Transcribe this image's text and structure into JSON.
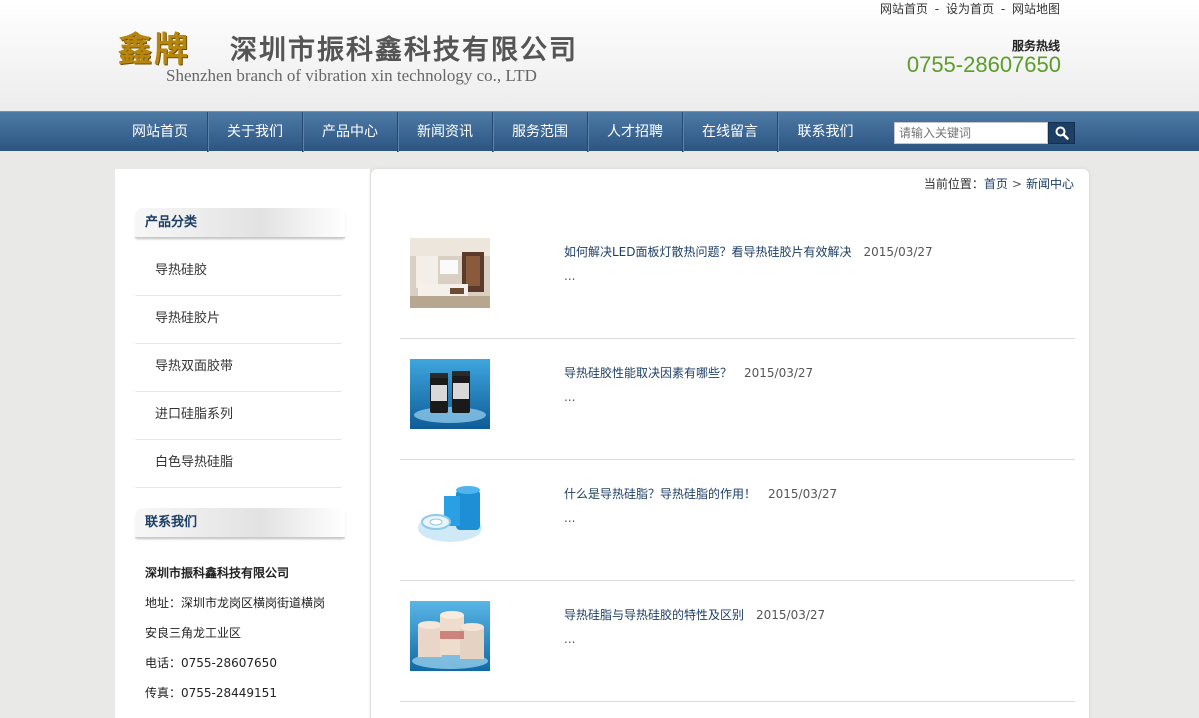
{
  "header": {
    "logo_brand": "鑫牌",
    "logo_cn": "深圳市振科鑫科技有限公司",
    "logo_en": "Shenzhen branch of vibration xin technology co., LTD",
    "top_links": [
      "网站首页",
      "设为首页",
      "网站地图"
    ],
    "top_link_sep": "-",
    "hotline_label": "服务热线",
    "hotline_number": "0755-28607650"
  },
  "nav": {
    "items": [
      "网站首页",
      "关于我们",
      "产品中心",
      "新闻资讯",
      "服务范围",
      "人才招聘",
      "在线留言",
      "联系我们"
    ],
    "search_placeholder": "请输入关键词",
    "search_icon": "search-icon"
  },
  "sidebar": {
    "category_heading": "产品分类",
    "categories": [
      "导热硅胶",
      "导热硅胶片",
      "导热双面胶带",
      "进口硅脂系列",
      "白色导热硅脂"
    ],
    "contact_heading": "联系我们",
    "contact_lines": [
      "深圳市振科鑫科技有限公司",
      "地址：深圳市龙岗区横岗街道横岗",
      "安良三角龙工业区",
      "电话：0755-28607650",
      "传真：0755-28449151"
    ]
  },
  "breadcrumb": {
    "prefix": "当前位置：",
    "home": "首页",
    "sep": ">",
    "current": "新闻中心"
  },
  "news": [
    {
      "title": "如何解决LED面板灯散热问题？看导热硅胶片有效解决",
      "date": "2015/03/27",
      "excerpt": "...",
      "thumb": "living-room-image"
    },
    {
      "title": "导热硅胶性能取决因素有哪些？",
      "date": "2015/03/27",
      "excerpt": "...",
      "thumb": "silicone-jars-image"
    },
    {
      "title": "什么是导热硅脂？导热硅脂的作用！",
      "date": "2015/03/27",
      "excerpt": "...",
      "thumb": "blue-tape-roll-image"
    },
    {
      "title": "导热硅脂与导热硅胶的特性及区别",
      "date": "2015/03/27",
      "excerpt": "...",
      "thumb": "grease-tubs-image"
    }
  ],
  "colors": {
    "nav_bg": "#2c5582",
    "link": "#1d3f66",
    "hotline": "#5a9e2a",
    "brand_gold": "#b8860b"
  }
}
